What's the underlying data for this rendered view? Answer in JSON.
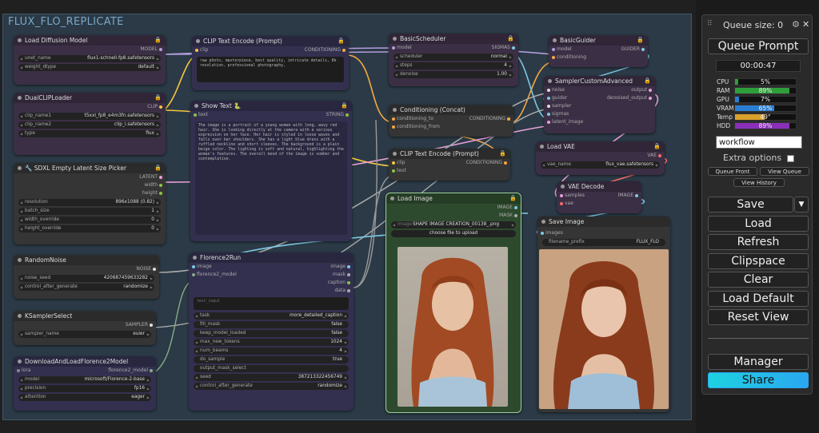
{
  "group_title": "FLUX_FLO_REPLICATE",
  "nodes": {
    "load_diffusion": {
      "title": "Load Diffusion Model",
      "out": "MODEL",
      "unet_name_label": "unet_name",
      "unet_name": "flux1-schnell-fp8.safetensors",
      "weight_dtype_label": "weight_dtype",
      "weight_dtype": "default"
    },
    "dualclip": {
      "title": "DualCLIPLoader",
      "out": "CLIP",
      "clip1_label": "clip_name1",
      "clip1": "t5xxl_fp8_e4m3fn.safetensors",
      "clip2_label": "clip_name2",
      "clip2": "clip_l.safetensors",
      "type_label": "type",
      "type": "flux"
    },
    "sdxl_latent": {
      "title": "🔧 SDXL Empty Latent Size Picker",
      "out1": "LATENT",
      "out2": "width",
      "out3": "height",
      "res_label": "resolution",
      "res": "896x1088 (0.82)",
      "batch_label": "batch_size",
      "batch": "1",
      "wo_label": "width_override",
      "wo": "0",
      "ho_label": "height_override",
      "ho": "0"
    },
    "random_noise": {
      "title": "RandomNoise",
      "out": "NOISE",
      "seed_label": "noise_seed",
      "seed": "420687459633282",
      "ctrl_label": "control_after_generate",
      "ctrl": "randomize"
    },
    "ksampler_select": {
      "title": "KSamplerSelect",
      "out": "SAMPLER",
      "sampler_label": "sampler_name",
      "sampler": "euler"
    },
    "download_florence": {
      "title": "DownloadAndLoadFlorence2Model",
      "in": "lora",
      "out": "florence2_model",
      "model_label": "model",
      "model": "microsoft/Florence-2-base",
      "precision_label": "precision",
      "precision": "fp16",
      "attention_label": "attention",
      "attention": "eager"
    },
    "clip_text_encode1": {
      "title": "CLIP Text Encode (Prompt)",
      "in": "clip",
      "out": "CONDITIONING",
      "text": "raw photo, masterpiece, best quality, intricate details, 8k resolution, professional photography,"
    },
    "show_text": {
      "title": "Show Text 🐍",
      "in": "text",
      "out": "STRING",
      "text": "The image is a portrait of a young woman with long, wavy red hair. She is looking directly at the camera with a serious expression on her face. Her hair is styled in loose waves and falls over her shoulders. She has a light blue dress with a ruffled neckline and short sleeves. The background is a plain beige color. The lighting is soft and natural, highlighting the woman's features. The overall mood of the image is somber and contemplative."
    },
    "florence2run": {
      "title": "Florence2Run",
      "in1": "image",
      "in2": "florence2_model",
      "out1": "image",
      "out2": "mask",
      "out3": "caption",
      "out4": "data",
      "text_input": "text_input",
      "task_label": "task",
      "task": "more_detailed_caption",
      "fill_label": "fill_mask",
      "fill": "false",
      "keep_label": "keep_model_loaded",
      "keep": "false",
      "tokens_label": "max_new_tokens",
      "tokens": "1024",
      "beams_label": "num_beams",
      "beams": "4",
      "sample_label": "do_sample",
      "sample": "true",
      "omask_label": "output_mask_select",
      "seed_label": "seed",
      "seed": "387213322456749",
      "ctrl_label": "control_after_generate",
      "ctrl": "randomize"
    },
    "basic_scheduler": {
      "title": "BasicScheduler",
      "in": "model",
      "out": "SIGMAS",
      "sched_label": "scheduler",
      "sched": "normal",
      "steps_label": "steps",
      "steps": "4",
      "denoise_label": "denoise",
      "denoise": "1.00"
    },
    "conditioning_concat": {
      "title": "Conditioning (Concat)",
      "in1": "conditioning_to",
      "in2": "conditioning_from",
      "out": "CONDITIONING"
    },
    "clip_text_encode2": {
      "title": "CLIP Text Encode (Prompt)",
      "in1": "clip",
      "in2": "text",
      "out": "CONDITIONING"
    },
    "load_image": {
      "title": "Load Image",
      "out1": "IMAGE",
      "out2": "MASK",
      "image_label": "image",
      "image": "SHAPE IMAGE CREATION_00138_.png",
      "upload": "choose file to upload"
    },
    "basic_guider": {
      "title": "BasicGuider",
      "in1": "model",
      "in2": "conditioning",
      "out": "GUIDER"
    },
    "sampler_custom_adv": {
      "title": "SamplerCustomAdvanced",
      "in1": "noise",
      "in2": "guider",
      "in3": "sampler",
      "in4": "sigmas",
      "in5": "latent_image",
      "out1": "output",
      "out2": "denoised_output"
    },
    "load_vae": {
      "title": "Load VAE",
      "out": "VAE",
      "vae_label": "vae_name",
      "vae": "flux_vae.safetensors"
    },
    "vae_decode": {
      "title": "VAE Decode",
      "in1": "samples",
      "in2": "vae",
      "out": "IMAGE"
    },
    "save_image": {
      "title": "Save Image",
      "in": "images",
      "prefix_label": "filename_prefix",
      "prefix": "FLUX_FLO"
    }
  },
  "panel": {
    "queue_size": "Queue size: 0",
    "queue_prompt": "Queue Prompt",
    "timer": "00:00:47",
    "stats": [
      {
        "label": "CPU",
        "pct": "5%",
        "value": 5,
        "color": "#2e9e3a"
      },
      {
        "label": "RAM",
        "pct": "89%",
        "value": 89,
        "color": "#2e9e3a"
      },
      {
        "label": "GPU",
        "pct": "7%",
        "value": 7,
        "color": "#2a7fd4"
      },
      {
        "label": "VRAM",
        "pct": "65%",
        "value": 65,
        "color": "#2a7fd4"
      },
      {
        "label": "Temp",
        "pct": "49°",
        "value": 49,
        "color": "#d9a02a"
      },
      {
        "label": "HDD",
        "pct": "89%",
        "value": 89,
        "color": "#8a2fb8"
      }
    ],
    "workflow_value": "workflow",
    "extra_options": "Extra options",
    "queue_front": "Queue Front",
    "view_queue": "View Queue",
    "view_history": "View History",
    "save": "Save",
    "load": "Load",
    "refresh": "Refresh",
    "clipspace": "Clipspace",
    "clear": "Clear",
    "load_default": "Load Default",
    "reset_view": "Reset View",
    "manager": "Manager",
    "share": "Share"
  }
}
